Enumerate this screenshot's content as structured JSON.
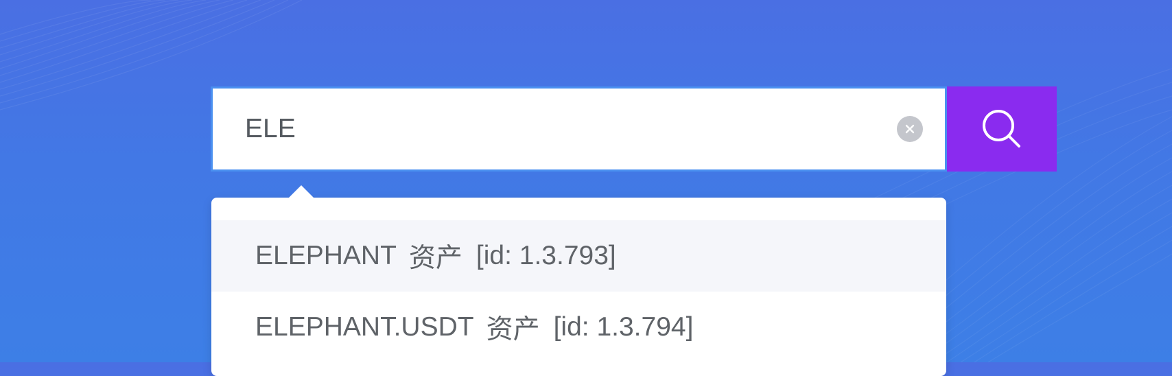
{
  "search": {
    "value": "ELE",
    "clear_icon": "close-circle-icon",
    "search_icon": "search-icon"
  },
  "suggestions": [
    {
      "name": "ELEPHANT",
      "type": "资产",
      "id": "[id: 1.3.793]"
    },
    {
      "name": "ELEPHANT.USDT",
      "type": "资产",
      "id": "[id: 1.3.794]"
    }
  ],
  "colors": {
    "background": "#4278e5",
    "input_border": "#4a90f0",
    "search_button": "#8a2bef",
    "clear_button": "#c4c6cc",
    "active_item": "#f5f6fa",
    "text": "#5f6368"
  }
}
